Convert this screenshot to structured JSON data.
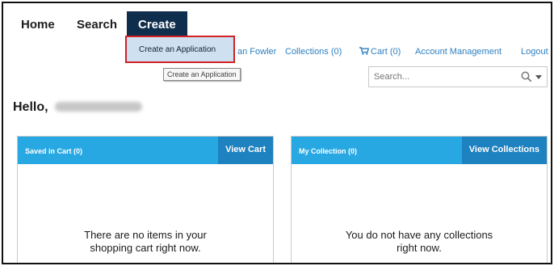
{
  "nav": {
    "home": "Home",
    "search": "Search",
    "create": "Create"
  },
  "create_menu": {
    "item": "Create an Application",
    "tooltip": "Create an Application"
  },
  "header_links": {
    "user_name_fragment": "an Fowler",
    "collections": "Collections (0)",
    "cart": "Cart (0)",
    "account_management": "Account Management",
    "logout": "Logout"
  },
  "search": {
    "placeholder": "Search..."
  },
  "greeting": {
    "text": "Hello,"
  },
  "cart_panel": {
    "title": "Saved in Cart (0)",
    "button": "View Cart",
    "empty_line1": "There are no items in your",
    "empty_line2": "shopping cart right now."
  },
  "collection_panel": {
    "title": "My Collection (0)",
    "button": "View Collections",
    "empty_line1": "You do not have any collections",
    "empty_line2": "right now."
  },
  "colors": {
    "nav_active": "#0f2d4c",
    "panel_header": "#27a8e2",
    "panel_button": "#1e81c0",
    "link": "#2d7fc0",
    "highlight_border": "#d32025"
  },
  "icons": [
    "cart-icon",
    "search-icon",
    "chevron-down-icon"
  ]
}
